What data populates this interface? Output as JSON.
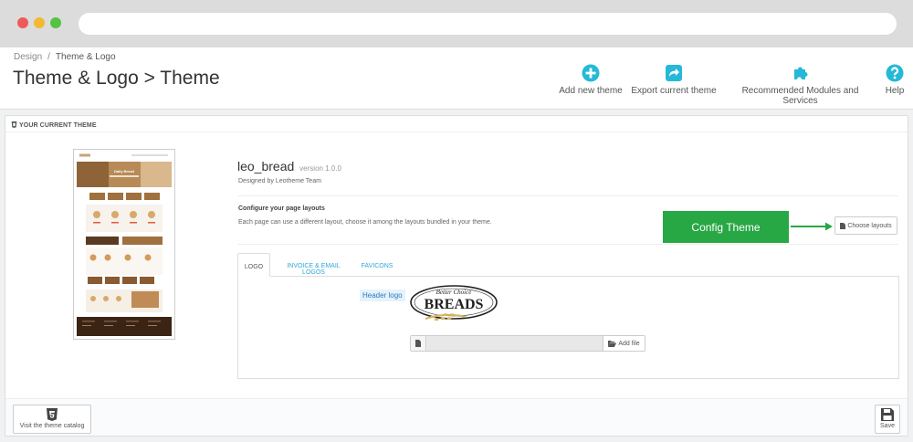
{
  "breadcrumb": {
    "parent": "Design",
    "separator": "/",
    "current": "Theme & Logo"
  },
  "page_title": "Theme & Logo > Theme",
  "toolbar": {
    "add_new_theme": "Add new theme",
    "export_current_theme": "Export current theme",
    "recommended_modules": "Recommended Modules and Services",
    "help": "Help"
  },
  "panel": {
    "heading": "YOUR CURRENT THEME",
    "theme_name": "leo_bread",
    "theme_version": "version 1.0.0",
    "author": "Designed by Leotheme Team",
    "configure_title": "Configure your page layouts",
    "configure_desc": "Each page can use a different layout, choose it among the layouts bundled in your theme.",
    "config_theme_label": "Config Theme",
    "choose_layouts": "Choose layouts",
    "thumbnail_banner": "Daily Bread",
    "tabs": [
      {
        "label": "LOGO",
        "active": true
      },
      {
        "label": "INVOICE & EMAIL LOGOS",
        "active": false
      },
      {
        "label": "FAVICONS",
        "active": false
      }
    ],
    "header_logo_label": "Header logo",
    "logo_text_top": "Better Choice",
    "logo_text_main": "BREADS",
    "add_file": "Add file"
  },
  "footer": {
    "catalog_button": "Visit the theme catalog",
    "save_button": "Save"
  },
  "colors": {
    "accent": "#25b9d7",
    "config_green": "#28a745",
    "link_blue": "#2ea8d7"
  },
  "icons": {
    "add": "plus-circle-icon",
    "export": "share-icon",
    "modules": "puzzle-icon",
    "help": "question-circle-icon",
    "html5": "html5-icon",
    "save": "floppy-icon",
    "file": "file-icon",
    "folder": "folder-open-icon"
  }
}
